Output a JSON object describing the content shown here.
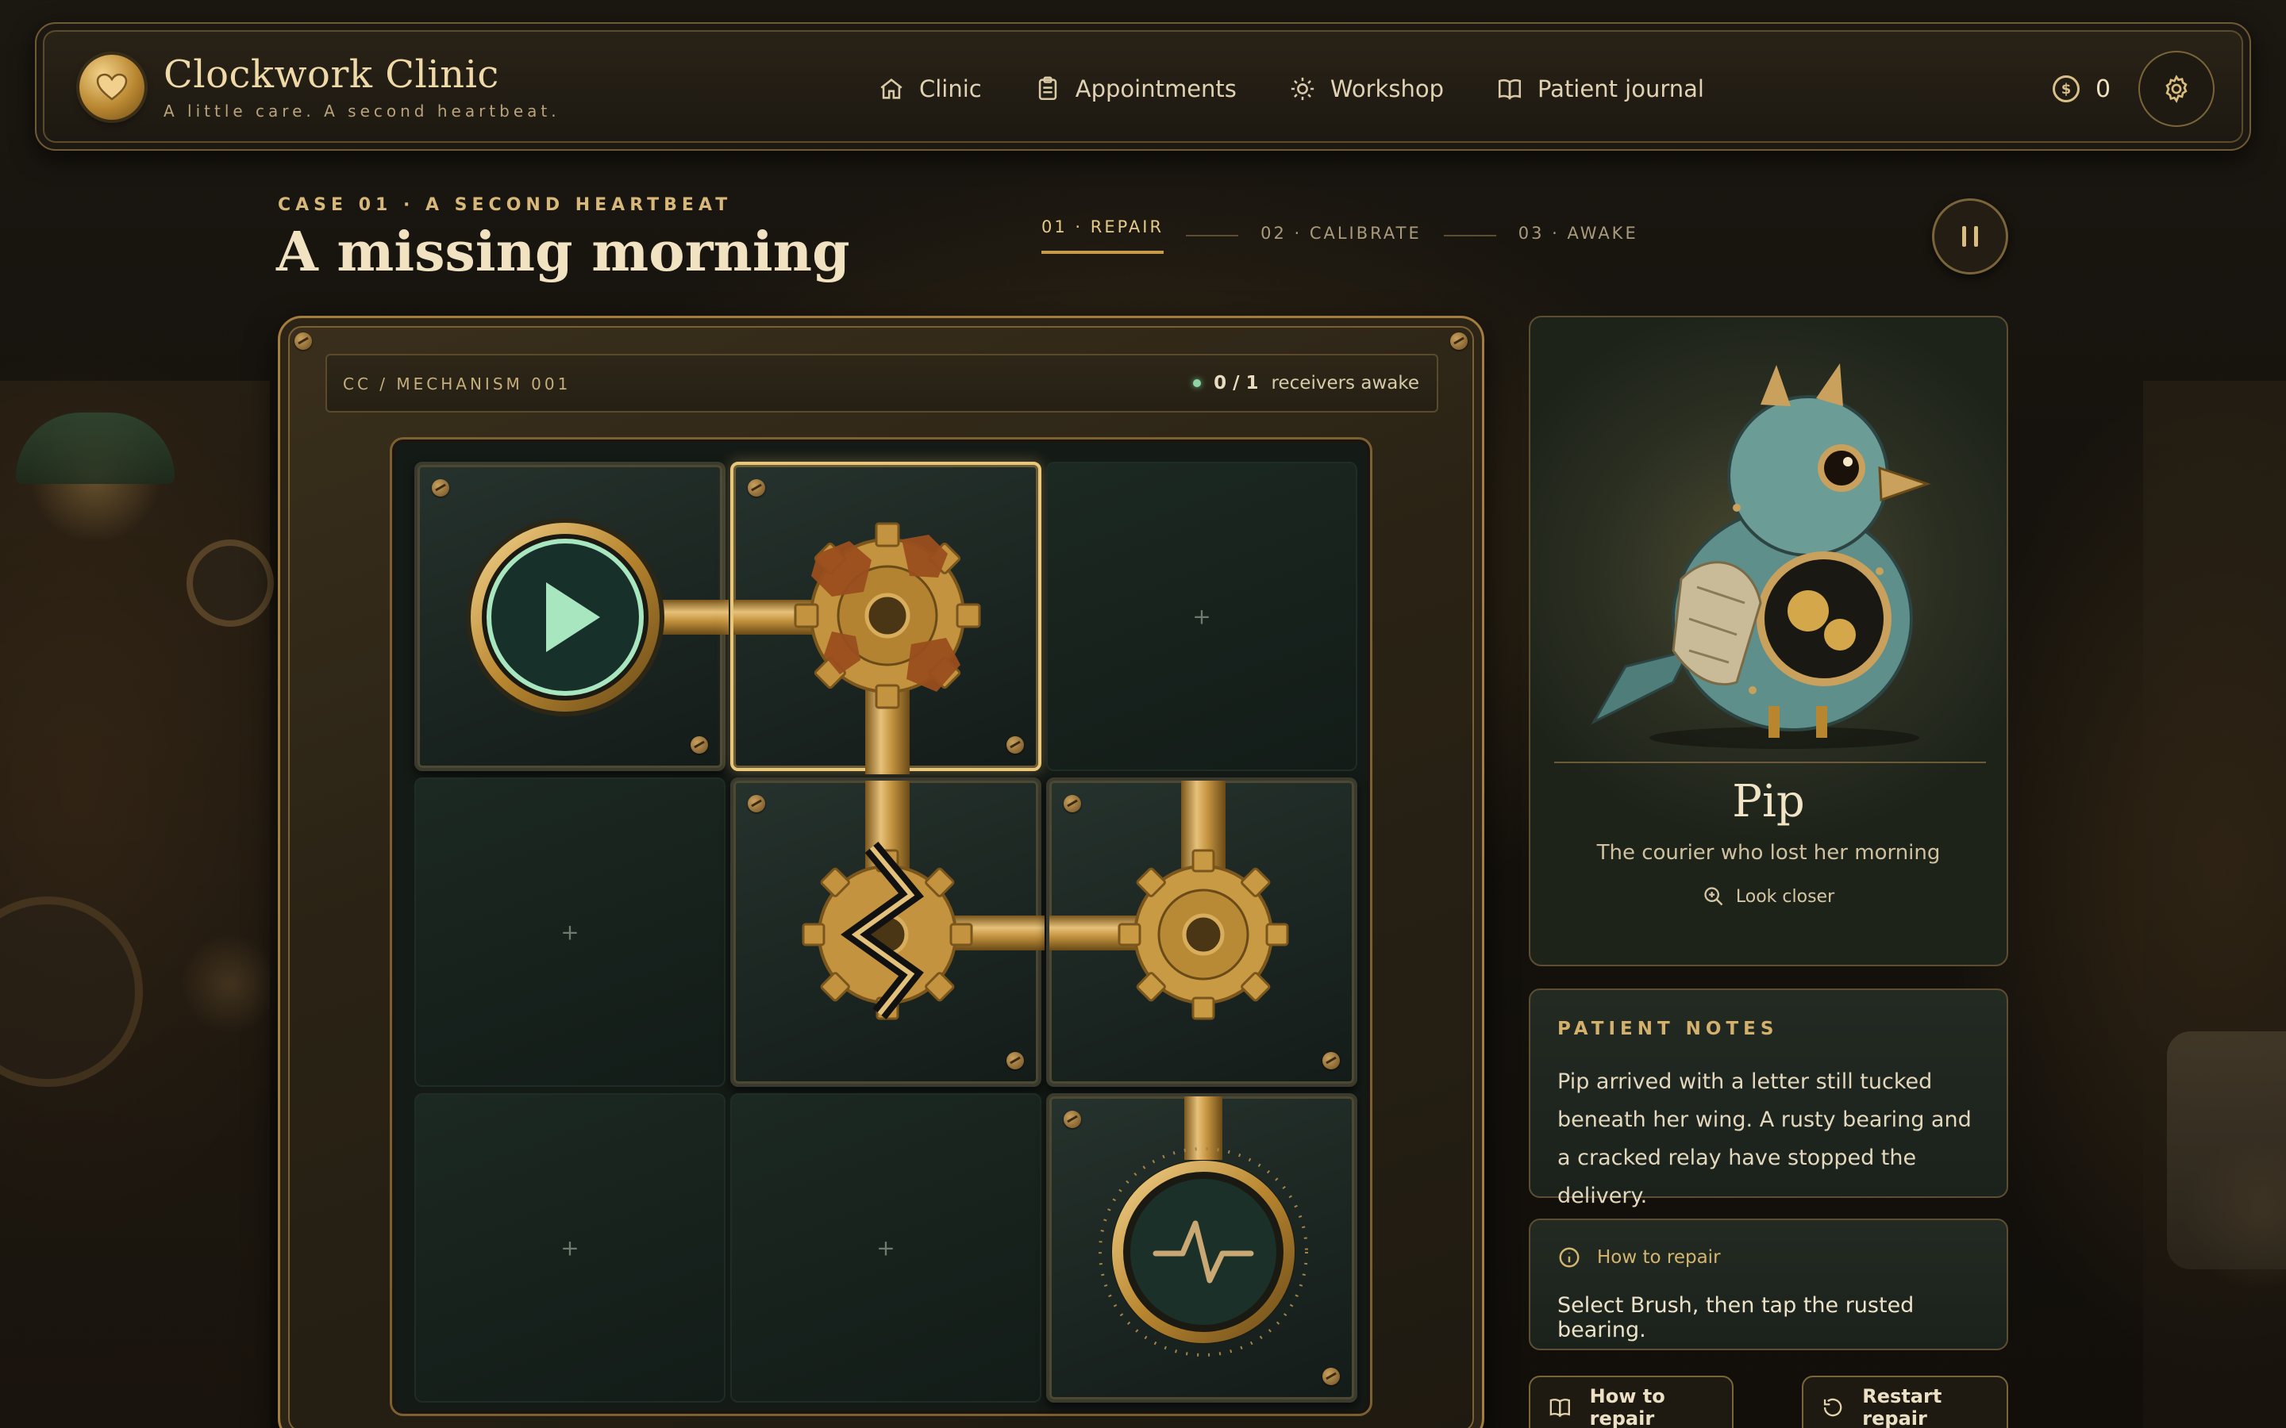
{
  "app": {
    "title": "Clockwork Clinic",
    "tagline": "A little care. A second heartbeat."
  },
  "nav": {
    "items": [
      {
        "label": "Clinic",
        "icon": "home-icon"
      },
      {
        "label": "Appointments",
        "icon": "clipboard-icon"
      },
      {
        "label": "Workshop",
        "icon": "gear-icon"
      },
      {
        "label": "Patient journal",
        "icon": "book-icon"
      }
    ]
  },
  "wallet": {
    "coins": "0",
    "icon": "coin-icon"
  },
  "case": {
    "label": "CASE 01 · A SECOND HEARTBEAT",
    "title": "A missing morning"
  },
  "steps": [
    {
      "label": "01 · REPAIR",
      "active": true
    },
    {
      "label": "02 · CALIBRATE",
      "active": false
    },
    {
      "label": "03 · AWAKE",
      "active": false
    }
  ],
  "mechanism": {
    "id": "CC / MECHANISM 001",
    "receivers_count": "0 / 1",
    "receivers_label": "receivers awake"
  },
  "board": {
    "rows": 3,
    "cols": 3,
    "empty_symbol": "+",
    "cells": [
      {
        "kind": "source",
        "name": "start-source"
      },
      {
        "kind": "rusted-gear",
        "name": "rusted-bearing",
        "selected": true
      },
      {
        "kind": "empty"
      },
      {
        "kind": "empty"
      },
      {
        "kind": "cracked-gear",
        "name": "cracked-relay"
      },
      {
        "kind": "gear",
        "name": "gear"
      },
      {
        "kind": "empty"
      },
      {
        "kind": "empty"
      },
      {
        "kind": "receiver",
        "name": "heartbeat-receiver"
      }
    ]
  },
  "patient": {
    "name": "Pip",
    "description": "The courier who lost her morning",
    "look_closer": "Look closer"
  },
  "notes": {
    "title": "PATIENT NOTES",
    "text": "Pip arrived with a letter still tucked beneath her wing. A rusty bearing and a cracked relay have stopped the delivery."
  },
  "howto": {
    "title": "How to repair",
    "text": "Select Brush, then tap the rusted bearing."
  },
  "buttons": {
    "howto": "How to repair",
    "restart": "Restart repair"
  },
  "colors": {
    "brass": "#c9a05c",
    "gold_accent": "#e4c987",
    "board_bg": "#141a16",
    "play_green": "#a8e6c0"
  }
}
